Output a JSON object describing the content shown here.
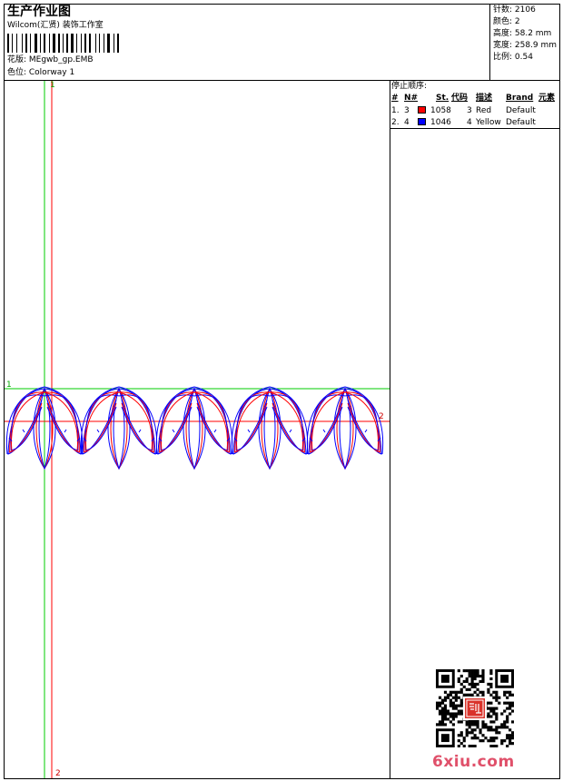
{
  "header": {
    "title": "生产作业图",
    "company": "Wilcom(汇贤) 装饰工作室",
    "design_line": "花版:  MEgwb_gp.EMB",
    "colorway_line": "色位:  Colorway 1"
  },
  "stats": [
    {
      "text": "针数: 2106"
    },
    {
      "text": "颜色: 2"
    },
    {
      "text": "高度: 58.2 mm"
    },
    {
      "text": "宽度: 258.9 mm"
    },
    {
      "text": "比例: 0.54"
    }
  ],
  "stop_sequence": {
    "title": "停止顺序:",
    "headers": {
      "num": "#",
      "needle": "N#",
      "st": "St.",
      "code": "代码",
      "desc": "描述",
      "brand": "Brand",
      "element": "元素"
    },
    "rows": [
      {
        "num": "1.",
        "needle": "3",
        "color": "#ff0000",
        "st": "1058",
        "code": "3",
        "desc": "Red",
        "brand": "Default"
      },
      {
        "num": "2.",
        "needle": "4",
        "color": "#0000ff",
        "st": "1046",
        "code": "4",
        "desc": "Yellow",
        "brand": "Default"
      }
    ]
  },
  "guides": {
    "label_top_left": "1",
    "label_left": "1",
    "label_right": "2",
    "label_bottom": "2"
  },
  "colors": {
    "thread_1": "#ff0000",
    "thread_2": "#0000ff",
    "guide_green": "#00cc00",
    "guide_red": "#ff0000"
  },
  "watermark": "6xiu.com",
  "qr_seal": "汇贤"
}
